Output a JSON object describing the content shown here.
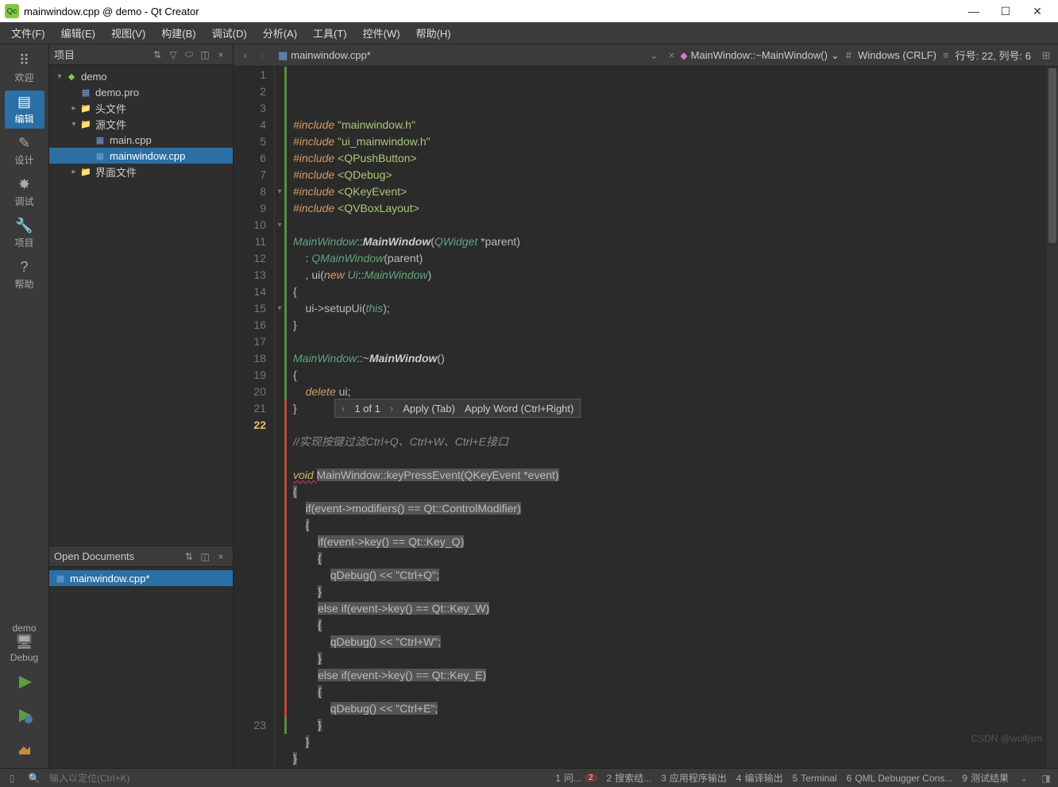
{
  "window": {
    "title": "mainwindow.cpp @ demo - Qt Creator"
  },
  "menubar": {
    "items": [
      {
        "label": "文件(F)"
      },
      {
        "label": "编辑(E)"
      },
      {
        "label": "视图(V)"
      },
      {
        "label": "构建(B)"
      },
      {
        "label": "调试(D)"
      },
      {
        "label": "分析(A)"
      },
      {
        "label": "工具(T)"
      },
      {
        "label": "控件(W)"
      },
      {
        "label": "帮助(H)"
      }
    ]
  },
  "modebar": {
    "items": [
      {
        "label": "欢迎",
        "icon": "⠿"
      },
      {
        "label": "编辑",
        "icon": "▤"
      },
      {
        "label": "设计",
        "icon": "✎"
      },
      {
        "label": "调试",
        "icon": "✸"
      },
      {
        "label": "项目",
        "icon": "🔧"
      },
      {
        "label": "帮助",
        "icon": "?"
      }
    ],
    "active_index": 1,
    "kit": {
      "name": "demo",
      "mode": "Debug"
    }
  },
  "project_panel": {
    "title": "项目",
    "tree": [
      {
        "depth": 0,
        "chev": "▾",
        "icon": "proj",
        "label": "demo"
      },
      {
        "depth": 1,
        "chev": "",
        "icon": "file",
        "label": "demo.pro"
      },
      {
        "depth": 1,
        "chev": "▸",
        "icon": "folder",
        "label": "头文件"
      },
      {
        "depth": 1,
        "chev": "▾",
        "icon": "folder",
        "label": "源文件"
      },
      {
        "depth": 2,
        "chev": "",
        "icon": "file",
        "label": "main.cpp"
      },
      {
        "depth": 2,
        "chev": "",
        "icon": "file",
        "label": "mainwindow.cpp",
        "selected": true
      },
      {
        "depth": 1,
        "chev": "▸",
        "icon": "folder",
        "label": "界面文件"
      }
    ]
  },
  "open_docs": {
    "title": "Open Documents",
    "items": [
      {
        "label": "mainwindow.cpp*"
      }
    ]
  },
  "editor_toolbar": {
    "filename": "mainwindow.cpp*",
    "symbol": "MainWindow::~MainWindow()",
    "encoding_label": "Windows (CRLF)",
    "cursor_label": "行号: 22, 列号: 6"
  },
  "suggest": {
    "counter": "1 of 1",
    "apply_tab": "Apply (Tab)",
    "apply_word": "Apply Word (Ctrl+Right)"
  },
  "code": {
    "lines": [
      {
        "n": 1,
        "cb": "g",
        "html": "<span class='pp'>#include</span> <span class='str'>\"mainwindow.h\"</span>"
      },
      {
        "n": 2,
        "cb": "g",
        "html": "<span class='pp'>#include</span> <span class='str'>\"ui_mainwindow.h\"</span>"
      },
      {
        "n": 3,
        "cb": "g",
        "html": "<span class='pp'>#include</span> <span class='str'>&lt;QPushButton&gt;</span>"
      },
      {
        "n": 4,
        "cb": "g",
        "html": "<span class='pp'>#include</span> <span class='str'>&lt;QDebug&gt;</span>"
      },
      {
        "n": 5,
        "cb": "g",
        "html": "<span class='pp'>#include</span> <span class='str'>&lt;QKeyEvent&gt;</span>"
      },
      {
        "n": 6,
        "cb": "g",
        "html": "<span class='pp'>#include</span> <span class='str'>&lt;QVBoxLayout&gt;</span>"
      },
      {
        "n": 7,
        "cb": "g",
        "html": ""
      },
      {
        "n": 8,
        "cb": "g",
        "fold": "▾",
        "html": "<span class='type'>MainWindow</span>::<span class='func'>MainWindow</span>(<span class='type'>QWidget</span> *parent)"
      },
      {
        "n": 9,
        "cb": "g",
        "html": "    : <span class='type'>QMainWindow</span>(parent)"
      },
      {
        "n": 10,
        "cb": "g",
        "fold": "▾",
        "html": "    , ui(<span class='new'>new</span> <span class='type'>Ui</span>::<span class='type'>MainWindow</span>)"
      },
      {
        "n": 11,
        "cb": "g",
        "html": "{"
      },
      {
        "n": 12,
        "cb": "g",
        "html": "    ui-&gt;setupUi(<span class='this'>this</span>);"
      },
      {
        "n": 13,
        "cb": "g",
        "html": "}"
      },
      {
        "n": 14,
        "cb": "g",
        "html": ""
      },
      {
        "n": 15,
        "cb": "g",
        "fold": "▾",
        "html": "<span class='type'>MainWindow</span>::~<span class='func'>MainWindow</span>()"
      },
      {
        "n": 16,
        "cb": "g",
        "html": "{"
      },
      {
        "n": 17,
        "cb": "g",
        "html": "    <span class='del'>delete</span> ui;"
      },
      {
        "n": 18,
        "cb": "g",
        "html": "}"
      },
      {
        "n": 19,
        "cb": "g",
        "html": ""
      },
      {
        "n": 20,
        "cb": "g",
        "html": "<span class='comment'>//实现按键过滤Ctrl+Q、Ctrl+W、Ctrl+E接口</span>"
      },
      {
        "n": 21,
        "cb": "r",
        "html": ""
      },
      {
        "n": 22,
        "cb": "r",
        "current": true,
        "html": "<span class='void-u'>void </span><span class='szone'>MainWindow::keyPressEvent(QKeyEvent *event)</span>"
      },
      {
        "n": "",
        "cb": "r",
        "html": "<span class='szone'>{</span>"
      },
      {
        "n": "",
        "cb": "r",
        "html": "    <span class='szone'>if(event-&gt;modifiers() == Qt::ControlModifier)</span>"
      },
      {
        "n": "",
        "cb": "r",
        "html": "    <span class='szone'>{</span>"
      },
      {
        "n": "",
        "cb": "r",
        "html": "        <span class='szone'>if(event-&gt;key() == Qt::Key_Q)</span>"
      },
      {
        "n": "",
        "cb": "r",
        "html": "        <span class='szone'>{</span>"
      },
      {
        "n": "",
        "cb": "r",
        "html": "            <span class='szone'>qDebug() &lt;&lt; \"Ctrl+Q\";</span>"
      },
      {
        "n": "",
        "cb": "r",
        "html": "        <span class='szone'>}</span>"
      },
      {
        "n": "",
        "cb": "r",
        "html": "        <span class='szone'>else if(event-&gt;key() == Qt::Key_W)</span>"
      },
      {
        "n": "",
        "cb": "r",
        "html": "        <span class='szone'>{</span>"
      },
      {
        "n": "",
        "cb": "r",
        "html": "            <span class='szone'>qDebug() &lt;&lt; \"Ctrl+W\";</span>"
      },
      {
        "n": "",
        "cb": "r",
        "html": "        <span class='szone'>}</span>"
      },
      {
        "n": "",
        "cb": "r",
        "html": "        <span class='szone'>else if(event-&gt;key() == Qt::Key_E)</span>"
      },
      {
        "n": "",
        "cb": "r",
        "html": "        <span class='szone'>{</span>"
      },
      {
        "n": "",
        "cb": "r",
        "html": "            <span class='szone'>qDebug() &lt;&lt; \"Ctrl+E\";</span>"
      },
      {
        "n": "",
        "cb": "r",
        "html": "        <span class='szone'>}</span>"
      },
      {
        "n": "",
        "cb": "r",
        "html": "    <span class='szone'>}</span>"
      },
      {
        "n": "",
        "cb": "r",
        "html": "<span class='szone'>}</span>"
      },
      {
        "n": 23,
        "cb": "g",
        "html": ""
      }
    ]
  },
  "statusbar": {
    "locator_placeholder": "输入以定位(Ctrl+K)",
    "tabs": [
      {
        "num": "1",
        "label": "问...",
        "err": true
      },
      {
        "num": "2",
        "label": "搜索结..."
      },
      {
        "num": "3",
        "label": "应用程序输出"
      },
      {
        "num": "4",
        "label": "编译输出"
      },
      {
        "num": "5",
        "label": "Terminal"
      },
      {
        "num": "6",
        "label": "QML Debugger Cons..."
      },
      {
        "num": "9",
        "label": "测试结果"
      }
    ],
    "issue_badge": "2"
  },
  "watermark": "CSDN @wolfjsm"
}
